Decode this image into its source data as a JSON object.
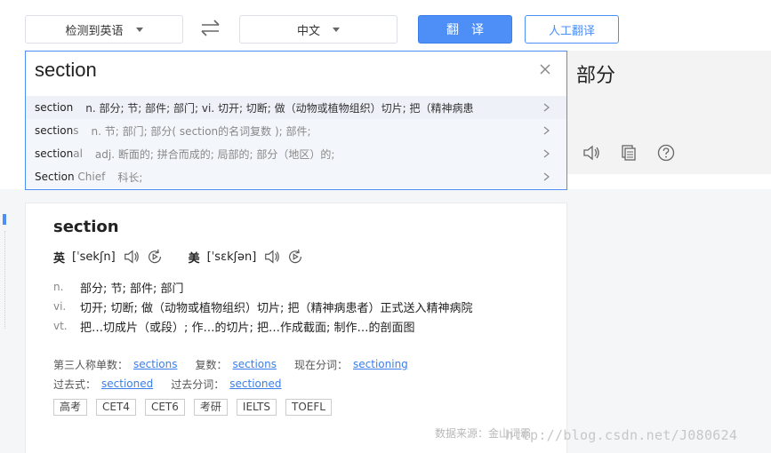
{
  "toolbar": {
    "source_lang": "检测到英语",
    "target_lang": "中文",
    "translate_label": "翻译",
    "human_label": "人工翻译"
  },
  "input": {
    "value": "section"
  },
  "suggestions": [
    {
      "word": "section",
      "tail": "",
      "def": "n. 部分; 节; 部件; 部门; vi. 切开; 切断; 做（动物或植物组织）切片; 把（精神病患"
    },
    {
      "word": "section",
      "tail": "s",
      "def": "n. 节; 部门; 部分( section的名词复数 ); 部件;"
    },
    {
      "word": "section",
      "tail": "al",
      "def": "adj. 断面的; 拼合而成的; 局部的; 部分（地区）的;"
    },
    {
      "word": "Section",
      "tail": " Chief",
      "def": "科长;"
    }
  ],
  "result": {
    "text": "部分",
    "icons": [
      "speaker-icon",
      "copy-icon",
      "help-icon"
    ]
  },
  "dict": {
    "word": "section",
    "uk_label": "英",
    "uk_ipa": "[ˈsekʃn]",
    "us_label": "美",
    "us_ipa": "[ˈsɛkʃən]",
    "definitions": [
      {
        "pos": "n.",
        "text": "部分;  节;  部件;  部门"
      },
      {
        "pos": "vi.",
        "text": "切开;  切断;  做（动物或植物组织）切片;  把（精神病患者）正式送入精神病院"
      },
      {
        "pos": "vt.",
        "text": "把…切成片（或段）;  作…的切片;  把…作成截面;  制作…的剖面图"
      }
    ],
    "forms": {
      "third_label": "第三人称单数：",
      "third": "sections",
      "plural_label": "复数：",
      "plural": "sections",
      "present_label": "现在分词：",
      "present": "sectioning",
      "past_label": "过去式：",
      "past": "sectioned",
      "pp_label": "过去分词：",
      "pp": "sectioned"
    },
    "tags": [
      "高考",
      "CET4",
      "CET6",
      "考研",
      "IELTS",
      "TOEFL"
    ],
    "source": "数据来源：金山词霸"
  },
  "watermark": "http://blog.csdn.net/J080624"
}
